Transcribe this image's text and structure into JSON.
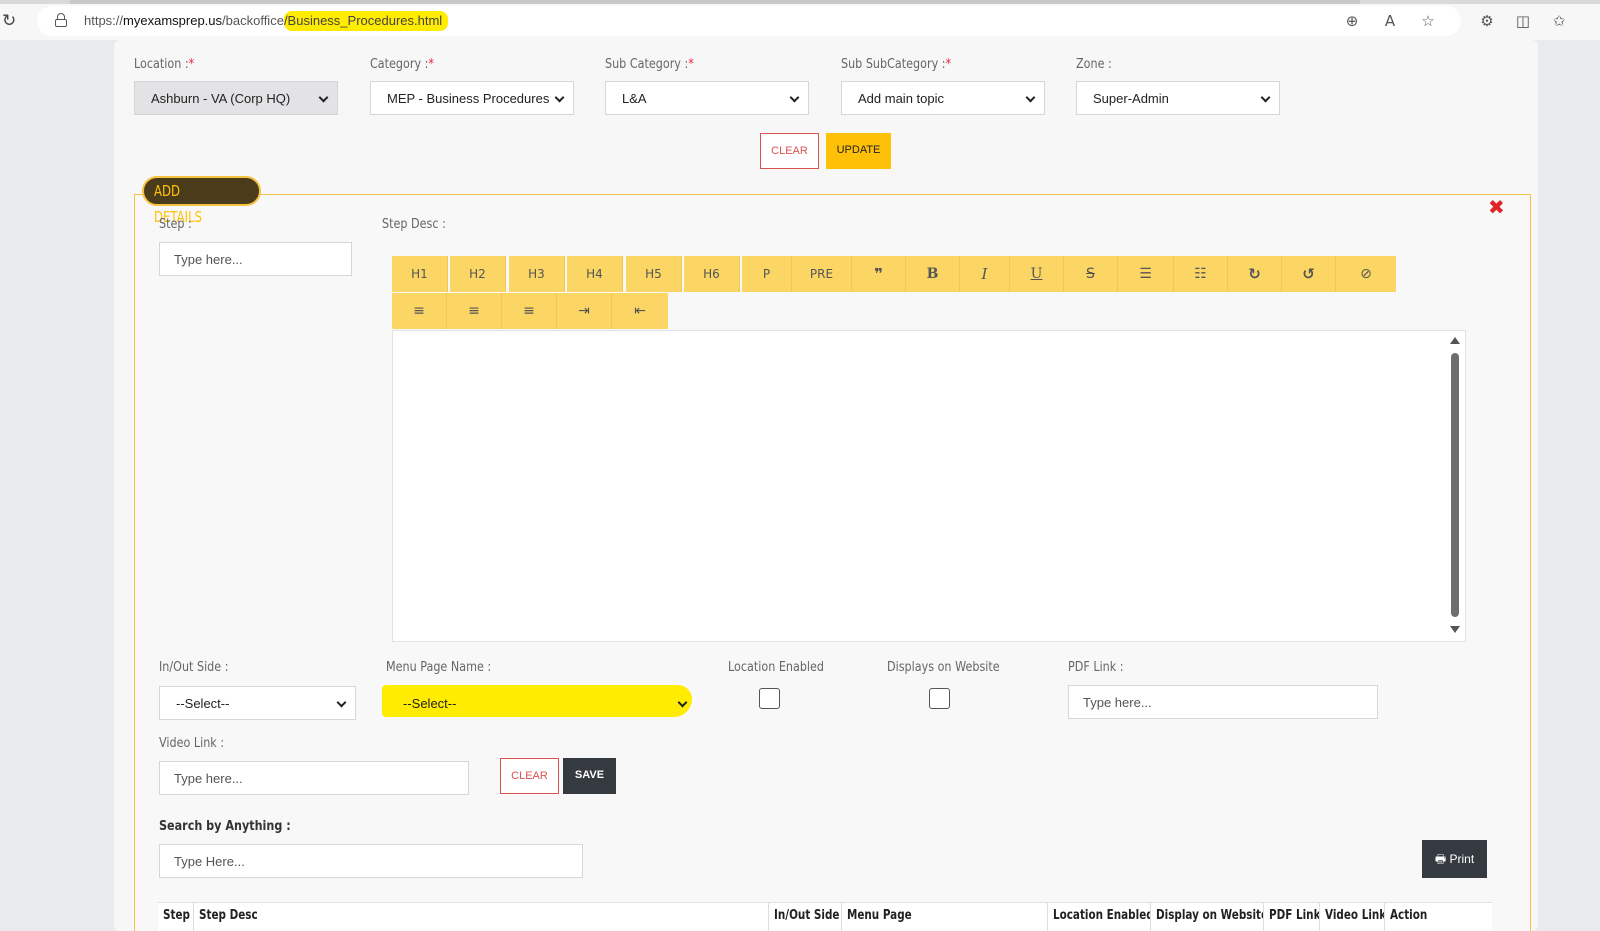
{
  "browser": {
    "url_prefix": "https://",
    "url_host": "myexamsprep.us",
    "url_path": "/backoffice",
    "url_highlight": "/Business_Procedures.html",
    "icons": [
      "reload-icon",
      "lock-icon",
      "zoom-icon",
      "read-aloud-icon",
      "favorite-star-icon",
      "extensions-icon",
      "split-screen-icon",
      "favorites-list-icon"
    ]
  },
  "filters": {
    "location": {
      "label": "Location :",
      "value": "Ashburn - VA (Corp HQ)"
    },
    "category": {
      "label": "Category :",
      "value": "MEP - Business Procedures"
    },
    "sub_category": {
      "label": "Sub Category :",
      "value": "L&A"
    },
    "sub_subcategory": {
      "label": "Sub SubCategory :",
      "value": "Add main topic"
    },
    "zone": {
      "label": "Zone :",
      "value": "Super-Admin"
    },
    "required_mark": "*",
    "clear_label": "CLEAR",
    "update_label": "UPDATE"
  },
  "details": {
    "legend": "ADD DETAILS",
    "close_glyph": "✖",
    "step_label": "Step :",
    "step_placeholder": "Type here...",
    "step_desc_label": "Step Desc :",
    "toolbar_row1": [
      "H1",
      "H2",
      "H3",
      "H4",
      "H5",
      "H6",
      "P",
      "PRE",
      "❞",
      "B",
      "I",
      "U",
      "S",
      "☰",
      "☷",
      "↻",
      "↺",
      "⊘"
    ],
    "toolbar_row2": [
      "≡",
      "≡",
      "≡",
      "⇥",
      "⇤"
    ],
    "in_out_label": "In/Out Side :",
    "in_out_value": "--Select--",
    "menu_page_label": "Menu Page Name :",
    "menu_page_value": "--Select--",
    "location_enabled_label": "Location Enabled",
    "displays_label": "Displays on Website",
    "pdf_label": "PDF Link :",
    "pdf_placeholder": "Type here...",
    "video_label": "Video Link :",
    "video_placeholder": "Type here...",
    "clear_label": "CLEAR",
    "save_label": "SAVE"
  },
  "search": {
    "label": "Search by Anything :",
    "placeholder": "Type Here...",
    "print_label": "Print",
    "print_icon": "🖶"
  },
  "table": {
    "columns": [
      "Step",
      "Step Desc",
      "In/Out Side",
      "Menu Page",
      "Location Enabled",
      "Display on Website",
      "PDF Link",
      "Video Link",
      "Action"
    ]
  }
}
